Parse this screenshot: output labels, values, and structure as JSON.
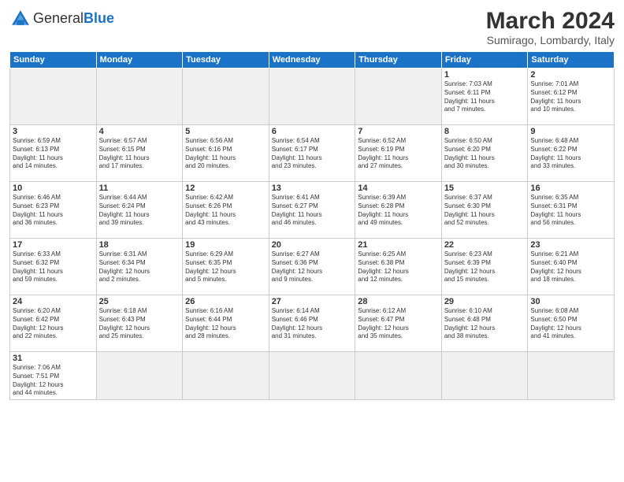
{
  "header": {
    "logo_general": "General",
    "logo_blue": "Blue",
    "title": "March 2024",
    "subtitle": "Sumirago, Lombardy, Italy"
  },
  "weekdays": [
    "Sunday",
    "Monday",
    "Tuesday",
    "Wednesday",
    "Thursday",
    "Friday",
    "Saturday"
  ],
  "weeks": [
    [
      {
        "day": "",
        "info": ""
      },
      {
        "day": "",
        "info": ""
      },
      {
        "day": "",
        "info": ""
      },
      {
        "day": "",
        "info": ""
      },
      {
        "day": "",
        "info": ""
      },
      {
        "day": "1",
        "info": "Sunrise: 7:03 AM\nSunset: 6:11 PM\nDaylight: 11 hours\nand 7 minutes."
      },
      {
        "day": "2",
        "info": "Sunrise: 7:01 AM\nSunset: 6:12 PM\nDaylight: 11 hours\nand 10 minutes."
      }
    ],
    [
      {
        "day": "3",
        "info": "Sunrise: 6:59 AM\nSunset: 6:13 PM\nDaylight: 11 hours\nand 14 minutes."
      },
      {
        "day": "4",
        "info": "Sunrise: 6:57 AM\nSunset: 6:15 PM\nDaylight: 11 hours\nand 17 minutes."
      },
      {
        "day": "5",
        "info": "Sunrise: 6:56 AM\nSunset: 6:16 PM\nDaylight: 11 hours\nand 20 minutes."
      },
      {
        "day": "6",
        "info": "Sunrise: 6:54 AM\nSunset: 6:17 PM\nDaylight: 11 hours\nand 23 minutes."
      },
      {
        "day": "7",
        "info": "Sunrise: 6:52 AM\nSunset: 6:19 PM\nDaylight: 11 hours\nand 27 minutes."
      },
      {
        "day": "8",
        "info": "Sunrise: 6:50 AM\nSunset: 6:20 PM\nDaylight: 11 hours\nand 30 minutes."
      },
      {
        "day": "9",
        "info": "Sunrise: 6:48 AM\nSunset: 6:22 PM\nDaylight: 11 hours\nand 33 minutes."
      }
    ],
    [
      {
        "day": "10",
        "info": "Sunrise: 6:46 AM\nSunset: 6:23 PM\nDaylight: 11 hours\nand 36 minutes."
      },
      {
        "day": "11",
        "info": "Sunrise: 6:44 AM\nSunset: 6:24 PM\nDaylight: 11 hours\nand 39 minutes."
      },
      {
        "day": "12",
        "info": "Sunrise: 6:42 AM\nSunset: 6:26 PM\nDaylight: 11 hours\nand 43 minutes."
      },
      {
        "day": "13",
        "info": "Sunrise: 6:41 AM\nSunset: 6:27 PM\nDaylight: 11 hours\nand 46 minutes."
      },
      {
        "day": "14",
        "info": "Sunrise: 6:39 AM\nSunset: 6:28 PM\nDaylight: 11 hours\nand 49 minutes."
      },
      {
        "day": "15",
        "info": "Sunrise: 6:37 AM\nSunset: 6:30 PM\nDaylight: 11 hours\nand 52 minutes."
      },
      {
        "day": "16",
        "info": "Sunrise: 6:35 AM\nSunset: 6:31 PM\nDaylight: 11 hours\nand 56 minutes."
      }
    ],
    [
      {
        "day": "17",
        "info": "Sunrise: 6:33 AM\nSunset: 6:32 PM\nDaylight: 11 hours\nand 59 minutes."
      },
      {
        "day": "18",
        "info": "Sunrise: 6:31 AM\nSunset: 6:34 PM\nDaylight: 12 hours\nand 2 minutes."
      },
      {
        "day": "19",
        "info": "Sunrise: 6:29 AM\nSunset: 6:35 PM\nDaylight: 12 hours\nand 5 minutes."
      },
      {
        "day": "20",
        "info": "Sunrise: 6:27 AM\nSunset: 6:36 PM\nDaylight: 12 hours\nand 9 minutes."
      },
      {
        "day": "21",
        "info": "Sunrise: 6:25 AM\nSunset: 6:38 PM\nDaylight: 12 hours\nand 12 minutes."
      },
      {
        "day": "22",
        "info": "Sunrise: 6:23 AM\nSunset: 6:39 PM\nDaylight: 12 hours\nand 15 minutes."
      },
      {
        "day": "23",
        "info": "Sunrise: 6:21 AM\nSunset: 6:40 PM\nDaylight: 12 hours\nand 18 minutes."
      }
    ],
    [
      {
        "day": "24",
        "info": "Sunrise: 6:20 AM\nSunset: 6:42 PM\nDaylight: 12 hours\nand 22 minutes."
      },
      {
        "day": "25",
        "info": "Sunrise: 6:18 AM\nSunset: 6:43 PM\nDaylight: 12 hours\nand 25 minutes."
      },
      {
        "day": "26",
        "info": "Sunrise: 6:16 AM\nSunset: 6:44 PM\nDaylight: 12 hours\nand 28 minutes."
      },
      {
        "day": "27",
        "info": "Sunrise: 6:14 AM\nSunset: 6:46 PM\nDaylight: 12 hours\nand 31 minutes."
      },
      {
        "day": "28",
        "info": "Sunrise: 6:12 AM\nSunset: 6:47 PM\nDaylight: 12 hours\nand 35 minutes."
      },
      {
        "day": "29",
        "info": "Sunrise: 6:10 AM\nSunset: 6:48 PM\nDaylight: 12 hours\nand 38 minutes."
      },
      {
        "day": "30",
        "info": "Sunrise: 6:08 AM\nSunset: 6:50 PM\nDaylight: 12 hours\nand 41 minutes."
      }
    ],
    [
      {
        "day": "31",
        "info": "Sunrise: 7:06 AM\nSunset: 7:51 PM\nDaylight: 12 hours\nand 44 minutes."
      },
      {
        "day": "",
        "info": ""
      },
      {
        "day": "",
        "info": ""
      },
      {
        "day": "",
        "info": ""
      },
      {
        "day": "",
        "info": ""
      },
      {
        "day": "",
        "info": ""
      },
      {
        "day": "",
        "info": ""
      }
    ]
  ]
}
